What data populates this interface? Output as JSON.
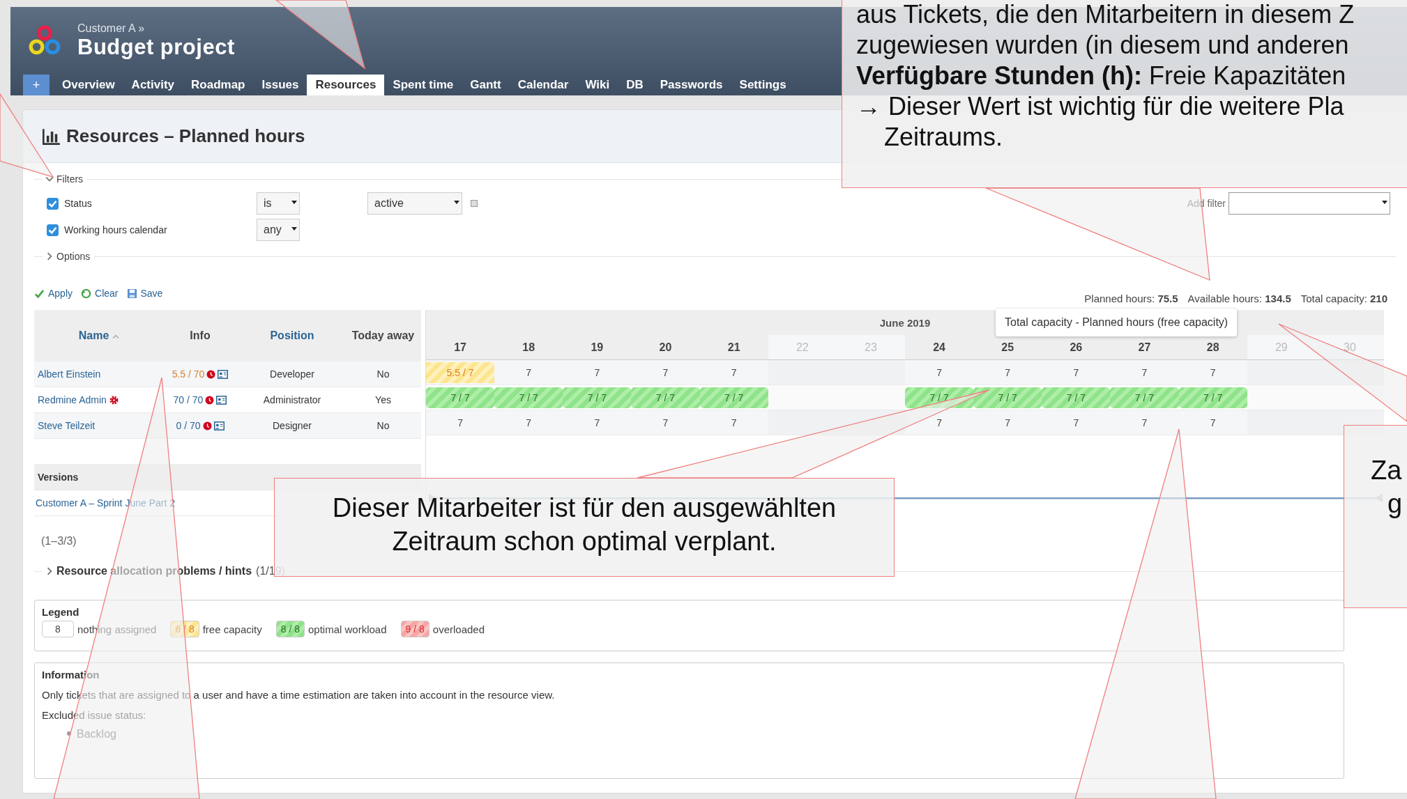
{
  "header": {
    "breadcrumb": "Customer A »",
    "title": "Budget project"
  },
  "new_button": "+",
  "tabs": [
    {
      "label": "Overview",
      "selected": false
    },
    {
      "label": "Activity",
      "selected": false
    },
    {
      "label": "Roadmap",
      "selected": false
    },
    {
      "label": "Issues",
      "selected": false
    },
    {
      "label": "Resources",
      "selected": true
    },
    {
      "label": "Spent time",
      "selected": false
    },
    {
      "label": "Gantt",
      "selected": false
    },
    {
      "label": "Calendar",
      "selected": false
    },
    {
      "label": "Wiki",
      "selected": false
    },
    {
      "label": "DB",
      "selected": false
    },
    {
      "label": "Passwords",
      "selected": false
    },
    {
      "label": "Settings",
      "selected": false
    }
  ],
  "page_title": "Resources – Planned hours",
  "filters": {
    "legend": "Filters",
    "expanded": true,
    "add_filter_label": "Add filter",
    "rows": [
      {
        "label": "Status",
        "checked": true,
        "operator": "is",
        "value": "active"
      },
      {
        "label": "Working hours calendar",
        "checked": true,
        "operator": "any"
      }
    ]
  },
  "options": {
    "label": "Options",
    "expanded": false
  },
  "actions": [
    {
      "label": "Apply",
      "kind": "apply"
    },
    {
      "label": "Clear",
      "kind": "clear"
    },
    {
      "label": "Save",
      "kind": "save"
    }
  ],
  "totals": [
    "Planned hours: **75.5**",
    "Available hours: **134.5**",
    "Total capacity: **210**"
  ],
  "table": {
    "columns": [
      {
        "label": "Name",
        "link": true,
        "sorted": true
      },
      {
        "label": "Info",
        "link": false,
        "sorted": false
      },
      {
        "label": "Position",
        "link": true,
        "sorted": false
      },
      {
        "label": "Today away",
        "link": false,
        "sorted": false
      }
    ],
    "rows": [
      {
        "name": "Albert Einstein",
        "admin": false,
        "info": "5.5 / 70",
        "partially_planned": true,
        "position": "Developer",
        "away": "No",
        "days": [
          {
            "text": "5.5 / 7",
            "kind": "free"
          },
          {
            "text": "7",
            "kind": "plain"
          },
          {
            "text": "7",
            "kind": "plain"
          },
          {
            "text": "7",
            "kind": "plain"
          },
          {
            "text": "7",
            "kind": "plain"
          },
          {
            "kind": "off"
          },
          {
            "kind": "off"
          },
          {
            "text": "7",
            "kind": "plain"
          },
          {
            "text": "7",
            "kind": "plain"
          },
          {
            "text": "7",
            "kind": "plain"
          },
          {
            "text": "7",
            "kind": "plain"
          },
          {
            "text": "7",
            "kind": "plain"
          },
          {
            "kind": "off"
          },
          {
            "kind": "off"
          }
        ]
      },
      {
        "name": "Redmine Admin",
        "admin": true,
        "info": "70 / 70",
        "partially_planned": false,
        "position": "Administrator",
        "away": "Yes",
        "days": [
          {
            "text": "7 / 7",
            "kind": "optimal"
          },
          {
            "text": "7 / 7",
            "kind": "optimal"
          },
          {
            "text": "7 / 7",
            "kind": "optimal"
          },
          {
            "text": "7 / 7",
            "kind": "optimal"
          },
          {
            "text": "7 / 7",
            "kind": "optimal"
          },
          {
            "kind": "off"
          },
          {
            "kind": "off"
          },
          {
            "text": "7 / 7",
            "kind": "optimal"
          },
          {
            "text": "7 / 7",
            "kind": "optimal"
          },
          {
            "text": "7 / 7",
            "kind": "optimal"
          },
          {
            "text": "7 / 7",
            "kind": "optimal"
          },
          {
            "text": "7 / 7",
            "kind": "optimal"
          },
          {
            "kind": "off"
          },
          {
            "kind": "off"
          }
        ]
      },
      {
        "name": "Steve Teilzeit",
        "admin": false,
        "info": "0 / 70",
        "partially_planned": false,
        "position": "Designer",
        "away": "No",
        "days": [
          {
            "text": "7",
            "kind": "plain"
          },
          {
            "text": "7",
            "kind": "plain"
          },
          {
            "text": "7",
            "kind": "plain"
          },
          {
            "text": "7",
            "kind": "plain"
          },
          {
            "text": "7",
            "kind": "plain"
          },
          {
            "kind": "off"
          },
          {
            "kind": "off"
          },
          {
            "text": "7",
            "kind": "plain"
          },
          {
            "text": "7",
            "kind": "plain"
          },
          {
            "text": "7",
            "kind": "plain"
          },
          {
            "text": "7",
            "kind": "plain"
          },
          {
            "text": "7",
            "kind": "plain"
          },
          {
            "kind": "off"
          },
          {
            "kind": "off"
          }
        ]
      }
    ],
    "versions_label": "Versions",
    "versions": [
      "Customer A – Sprint June Part 2"
    ]
  },
  "gantt": {
    "month": "June 2019",
    "days": [
      {
        "label": "17",
        "weekend": false
      },
      {
        "label": "18",
        "weekend": false
      },
      {
        "label": "19",
        "weekend": false
      },
      {
        "label": "20",
        "weekend": false
      },
      {
        "label": "21",
        "weekend": false
      },
      {
        "label": "22",
        "weekend": true
      },
      {
        "label": "23",
        "weekend": true
      },
      {
        "label": "24",
        "weekend": false
      },
      {
        "label": "25",
        "weekend": false
      },
      {
        "label": "26",
        "weekend": false
      },
      {
        "label": "27",
        "weekend": false
      },
      {
        "label": "28",
        "weekend": false
      },
      {
        "label": "29",
        "weekend": true
      },
      {
        "label": "30",
        "weekend": true
      }
    ]
  },
  "pagination": "(1–3/3)",
  "problems": {
    "label": "Resource allocation problems / hints",
    "count": "(1/19)"
  },
  "legend": {
    "title": "Legend",
    "items": [
      {
        "sample": "8",
        "kind": "plain",
        "label": "nothing assigned"
      },
      {
        "sample": "6 / 8",
        "kind": "free",
        "label": "free capacity"
      },
      {
        "sample": "8 / 8",
        "kind": "optimal",
        "label": "optimal workload"
      },
      {
        "sample": "9 / 8",
        "kind": "overloaded",
        "label": "overloaded"
      }
    ]
  },
  "information": {
    "title": "Information",
    "text": "Only tickets that are assigned to a user and have a time estimation are taken into account in the resource view.",
    "excluded_label": "Excluded issue status:",
    "excluded": [
      "Backlog"
    ]
  },
  "tooltip": "Total capacity - Planned hours (free capacity)",
  "callouts": [
    {
      "kind": "top",
      "lines": [
        "aus Tickets, die den Mitarbeitern in diesem Z",
        "zugewiesen wurden (in diesem und anderen",
        "**Verfügbare Stunden (h):** Freie Kapazitäten",
        "→ Dieser Wert ist wichtig für die weitere Pla",
        "Zeitraums."
      ]
    },
    {
      "kind": "middle",
      "lines": [
        "Dieser Mitarbeiter ist für den ausgewählten",
        "Zeitraum schon optimal verplant."
      ]
    },
    {
      "kind": "edge",
      "lines": [
        "Za",
        "g"
      ]
    }
  ]
}
